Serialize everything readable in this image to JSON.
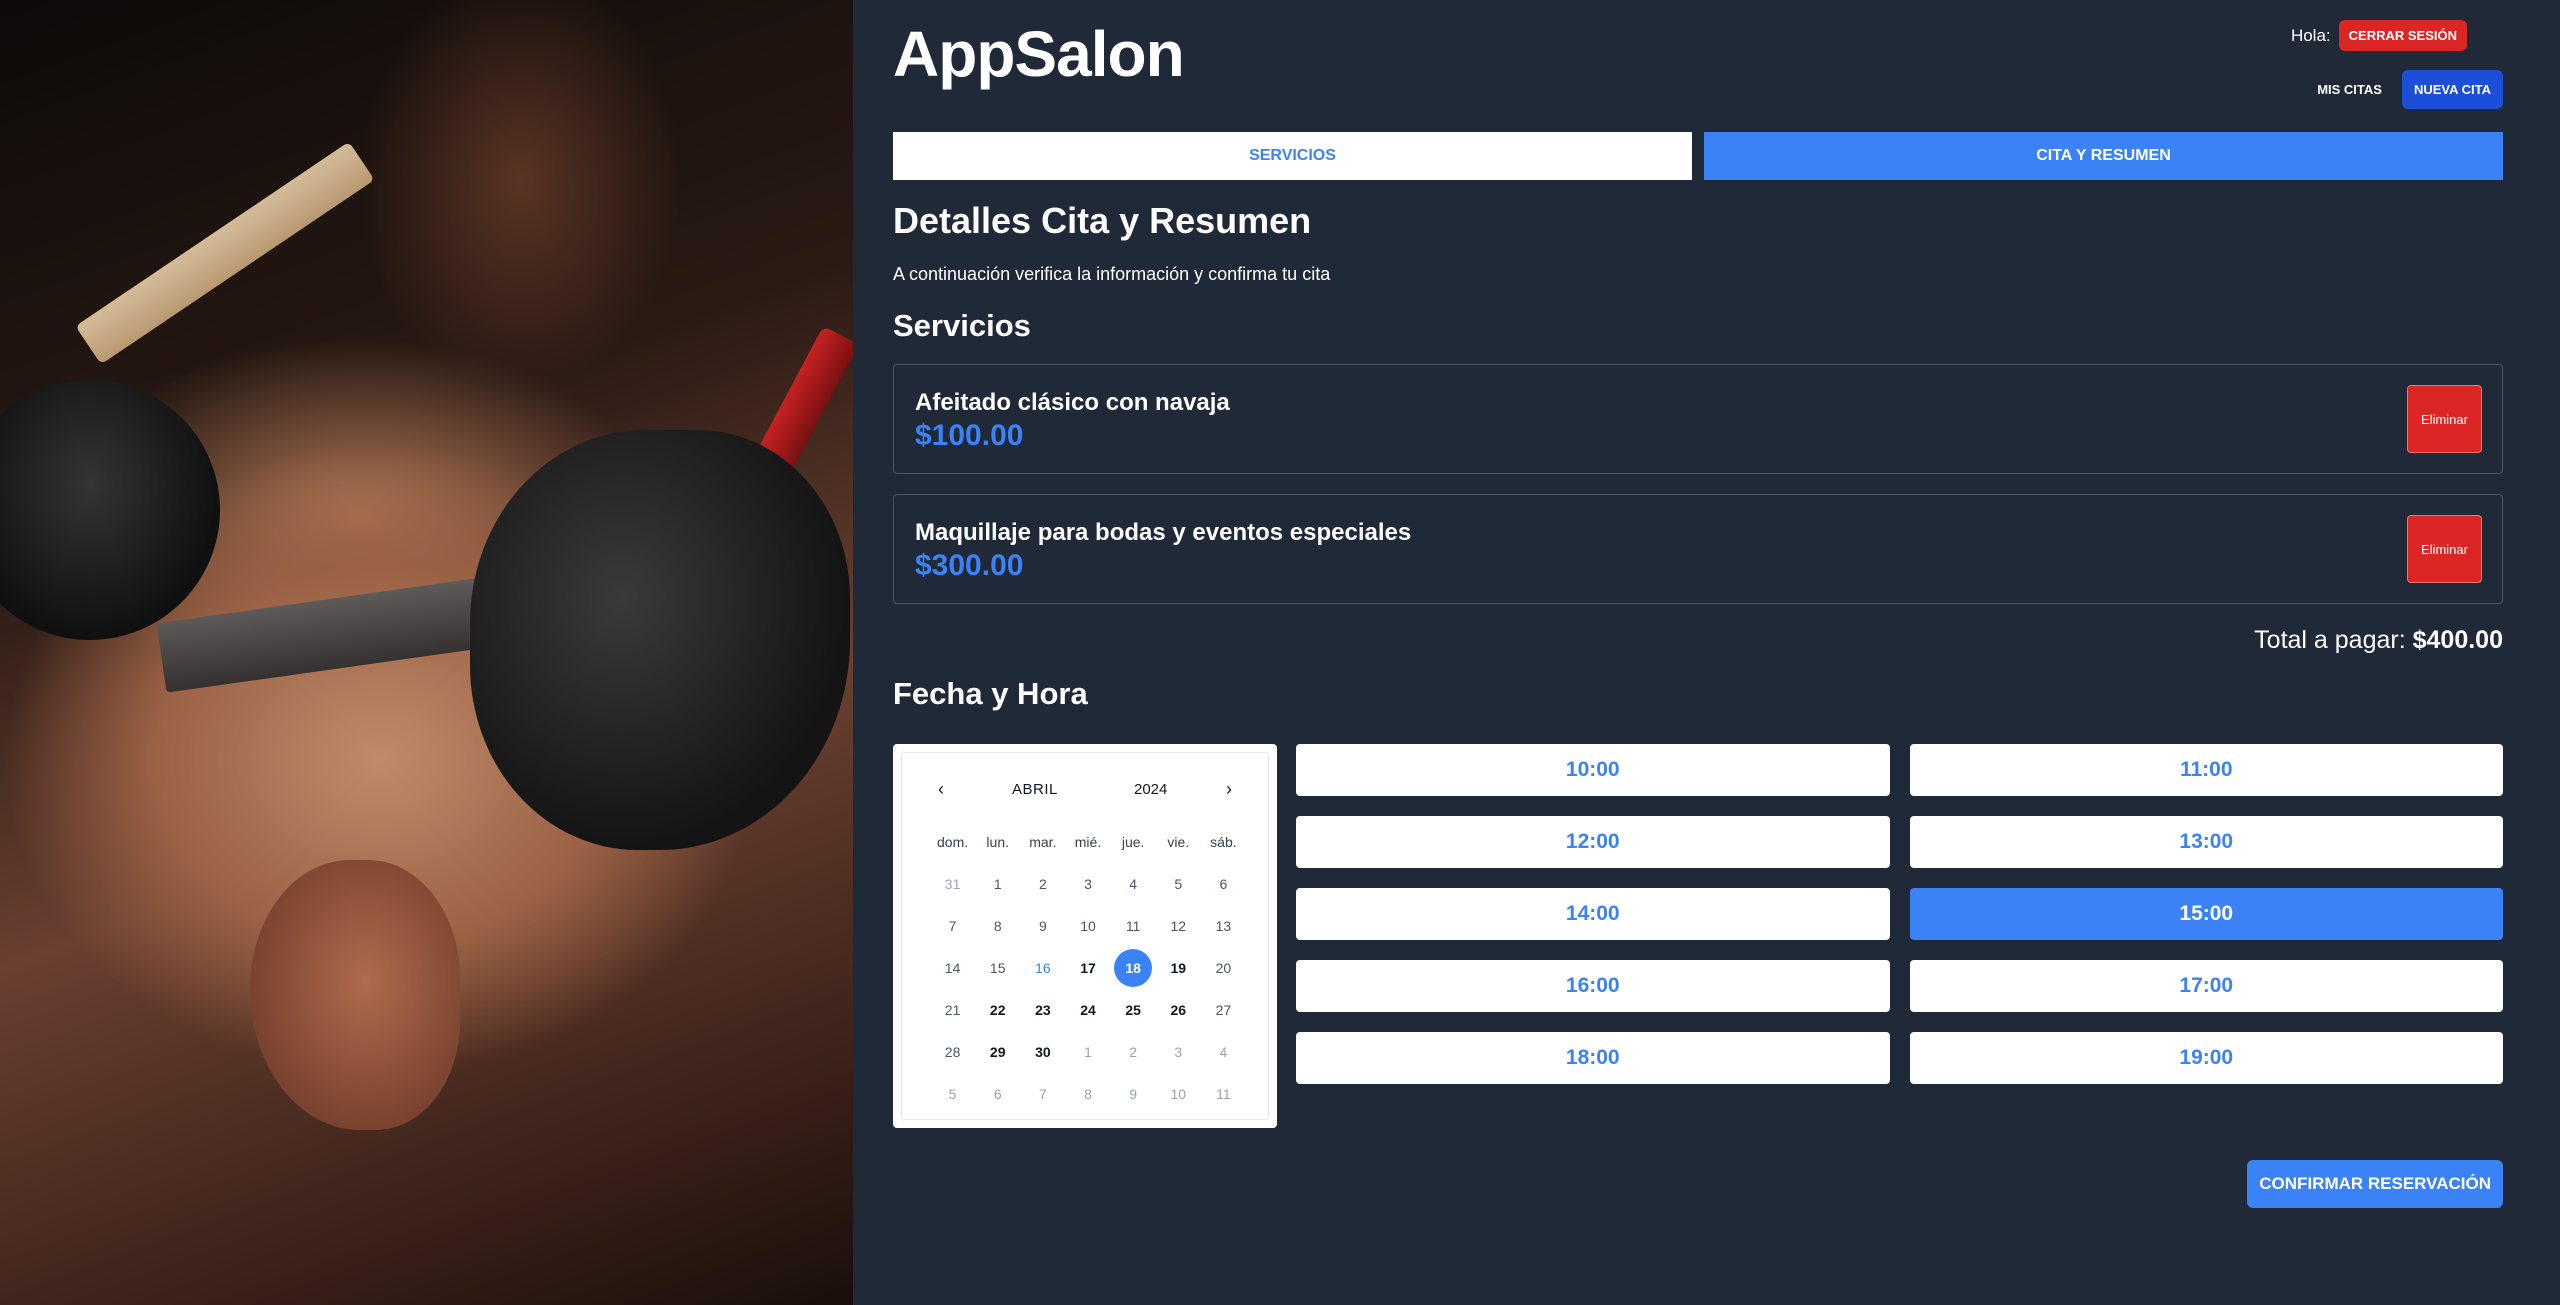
{
  "header": {
    "logo": "AppSalon",
    "greeting": "Hola:",
    "logout_label": "CERRAR SESIÓN",
    "nav": {
      "mis_citas": "MIS CITAS",
      "nueva_cita": "NUEVA CITA"
    }
  },
  "tabs": [
    {
      "label": "SERVICIOS",
      "active": false
    },
    {
      "label": "CITA Y RESUMEN",
      "active": true
    }
  ],
  "main": {
    "title": "Detalles Cita y Resumen",
    "subtitle": "A continuación verifica la información y confirma tu cita",
    "services_heading": "Servicios",
    "services": [
      {
        "name": "Afeitado clásico con navaja",
        "price": "$100.00",
        "remove_label": "Eliminar"
      },
      {
        "name": "Maquillaje para bodas y eventos especiales",
        "price": "$300.00",
        "remove_label": "Eliminar"
      }
    ],
    "total_label": "Total a pagar:",
    "total_value": "$400.00",
    "datetime_heading": "Fecha y Hora"
  },
  "calendar": {
    "month": "ABRIL",
    "year": "2024",
    "prev_icon": "chevron-left-icon",
    "next_icon": "chevron-right-icon",
    "weekdays": [
      "dom.",
      "lun.",
      "mar.",
      "mié.",
      "jue.",
      "vie.",
      "sáb."
    ],
    "weeks": [
      [
        {
          "d": "31",
          "s": "other"
        },
        {
          "d": "1",
          "s": "disabled"
        },
        {
          "d": "2",
          "s": "disabled"
        },
        {
          "d": "3",
          "s": "disabled"
        },
        {
          "d": "4",
          "s": "disabled"
        },
        {
          "d": "5",
          "s": "disabled"
        },
        {
          "d": "6",
          "s": "disabled"
        }
      ],
      [
        {
          "d": "7",
          "s": "disabled"
        },
        {
          "d": "8",
          "s": "disabled"
        },
        {
          "d": "9",
          "s": "disabled"
        },
        {
          "d": "10",
          "s": "disabled"
        },
        {
          "d": "11",
          "s": "disabled"
        },
        {
          "d": "12",
          "s": "disabled"
        },
        {
          "d": "13",
          "s": "disabled"
        }
      ],
      [
        {
          "d": "14",
          "s": "disabled"
        },
        {
          "d": "15",
          "s": "disabled"
        },
        {
          "d": "16",
          "s": "today"
        },
        {
          "d": "17",
          "s": "avail"
        },
        {
          "d": "18",
          "s": "selected"
        },
        {
          "d": "19",
          "s": "avail"
        },
        {
          "d": "20",
          "s": "disabled"
        }
      ],
      [
        {
          "d": "21",
          "s": "disabled"
        },
        {
          "d": "22",
          "s": "avail"
        },
        {
          "d": "23",
          "s": "avail"
        },
        {
          "d": "24",
          "s": "avail"
        },
        {
          "d": "25",
          "s": "avail"
        },
        {
          "d": "26",
          "s": "avail"
        },
        {
          "d": "27",
          "s": "disabled"
        }
      ],
      [
        {
          "d": "28",
          "s": "disabled"
        },
        {
          "d": "29",
          "s": "avail"
        },
        {
          "d": "30",
          "s": "avail"
        },
        {
          "d": "1",
          "s": "other"
        },
        {
          "d": "2",
          "s": "other"
        },
        {
          "d": "3",
          "s": "other"
        },
        {
          "d": "4",
          "s": "other"
        }
      ],
      [
        {
          "d": "5",
          "s": "other"
        },
        {
          "d": "6",
          "s": "other"
        },
        {
          "d": "7",
          "s": "other"
        },
        {
          "d": "8",
          "s": "other"
        },
        {
          "d": "9",
          "s": "other"
        },
        {
          "d": "10",
          "s": "other"
        },
        {
          "d": "11",
          "s": "other"
        }
      ]
    ]
  },
  "time_slots": [
    {
      "time": "10:00",
      "selected": false
    },
    {
      "time": "11:00",
      "selected": false
    },
    {
      "time": "12:00",
      "selected": false
    },
    {
      "time": "13:00",
      "selected": false
    },
    {
      "time": "14:00",
      "selected": false
    },
    {
      "time": "15:00",
      "selected": true
    },
    {
      "time": "16:00",
      "selected": false
    },
    {
      "time": "17:00",
      "selected": false
    },
    {
      "time": "18:00",
      "selected": false
    },
    {
      "time": "19:00",
      "selected": false
    }
  ],
  "confirm_label": "CONFIRMAR RESERVACIÓN",
  "colors": {
    "background": "#1f2937",
    "primary": "#3b82f6",
    "danger": "#dc2626",
    "nav_button": "#1d4ed8"
  }
}
